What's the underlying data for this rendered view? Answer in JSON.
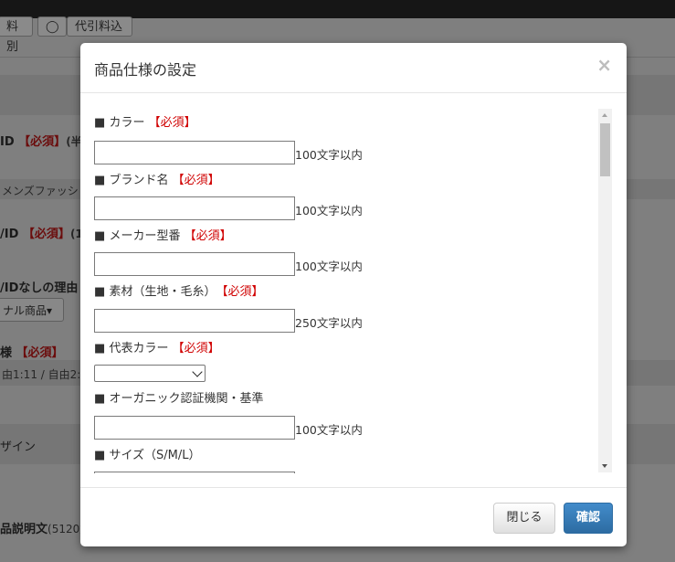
{
  "background": {
    "top_buttons": [
      "料別",
      "代引料込"
    ],
    "radio_mark": "◯",
    "rows": {
      "id_label": "ID",
      "required_tag": "【必須】",
      "id_suffix": "(半",
      "category_text": "メンズファッシ",
      "id2_label": "/ID",
      "id2_suffix": "(1",
      "reason_label": "/IDなしの理由",
      "reason_dropdown": "ナル商品▾",
      "spec_label": "様",
      "spec_values": "由1:11 / 自由2:2",
      "design_label": "ザイン",
      "desc_label": "品説明文",
      "desc_suffix": "(5120文"
    }
  },
  "modal": {
    "title": "商品仕様の設定",
    "close_icon": "×",
    "bullet": "■",
    "fields": [
      {
        "label": "カラー",
        "required": "【必須】",
        "type": "text",
        "hint": "100文字以内",
        "value": ""
      },
      {
        "label": "ブランド名",
        "required": "【必須】",
        "type": "text",
        "hint": "100文字以内",
        "value": ""
      },
      {
        "label": "メーカー型番",
        "required": "【必須】",
        "type": "text",
        "hint": "100文字以内",
        "value": ""
      },
      {
        "label": "素材（生地・毛糸）",
        "required": "【必須】",
        "type": "text",
        "hint": "250文字以内",
        "value": ""
      },
      {
        "label": "代表カラー",
        "required": "【必須】",
        "type": "select",
        "hint": "",
        "value": ""
      },
      {
        "label": "オーガニック認証機関・基準",
        "required": "",
        "type": "text",
        "hint": "100文字以内",
        "value": ""
      },
      {
        "label": "サイズ（S/M/L）",
        "required": "",
        "type": "text",
        "hint": "",
        "value": ""
      }
    ],
    "footer": {
      "close_label": "閉じる",
      "confirm_label": "確認"
    }
  }
}
